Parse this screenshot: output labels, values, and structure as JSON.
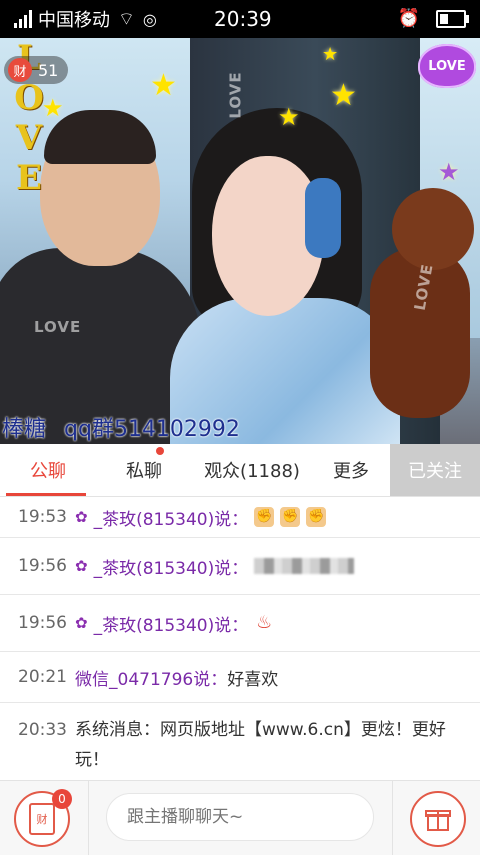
{
  "status_bar": {
    "carrier": "中国移动",
    "time": "20:39",
    "icons": [
      "signal-icon",
      "wifi-icon",
      "wechat-icon",
      "alarm-icon",
      "battery-icon"
    ]
  },
  "video": {
    "badge_icon_text": "财",
    "badge_count": "51",
    "love_letters": [
      "L",
      "O",
      "V",
      "E"
    ],
    "heart_label": "LOVE",
    "overlay_caption_left": "棒糖",
    "overlay_caption_right": "qq群514102992",
    "watermark": "LOVE"
  },
  "tabs": [
    {
      "label": "公聊",
      "active": true
    },
    {
      "label": "私聊",
      "has_dot": true
    },
    {
      "label": "观众(1188)"
    },
    {
      "label": "更多"
    },
    {
      "label": "已关注"
    }
  ],
  "chat": [
    {
      "time": "19:53",
      "user": "_茶玫(815340)说：",
      "content_type": "emoji",
      "emojis": [
        "✊",
        "✊",
        "✊"
      ]
    },
    {
      "time": "19:56",
      "user": "_茶玫(815340)说：",
      "content_type": "blurred"
    },
    {
      "time": "19:56",
      "user": "_茶玫(815340)说：",
      "content_type": "emoji_red",
      "emojis": [
        "♨"
      ]
    },
    {
      "time": "20:21",
      "user": "微信_0471796说：",
      "text": "好喜欢"
    },
    {
      "time": "20:33",
      "text": "系统消息：网页版地址【www.6.cn】更炫！更好玩！"
    }
  ],
  "bottom_bar": {
    "gift_icon_text": "财",
    "gift_count": "0",
    "input_placeholder": "跟主播聊聊天~"
  },
  "colors": {
    "accent": "#e8463a",
    "username": "#7a2aa8",
    "follow_bg": "#cccccc"
  }
}
